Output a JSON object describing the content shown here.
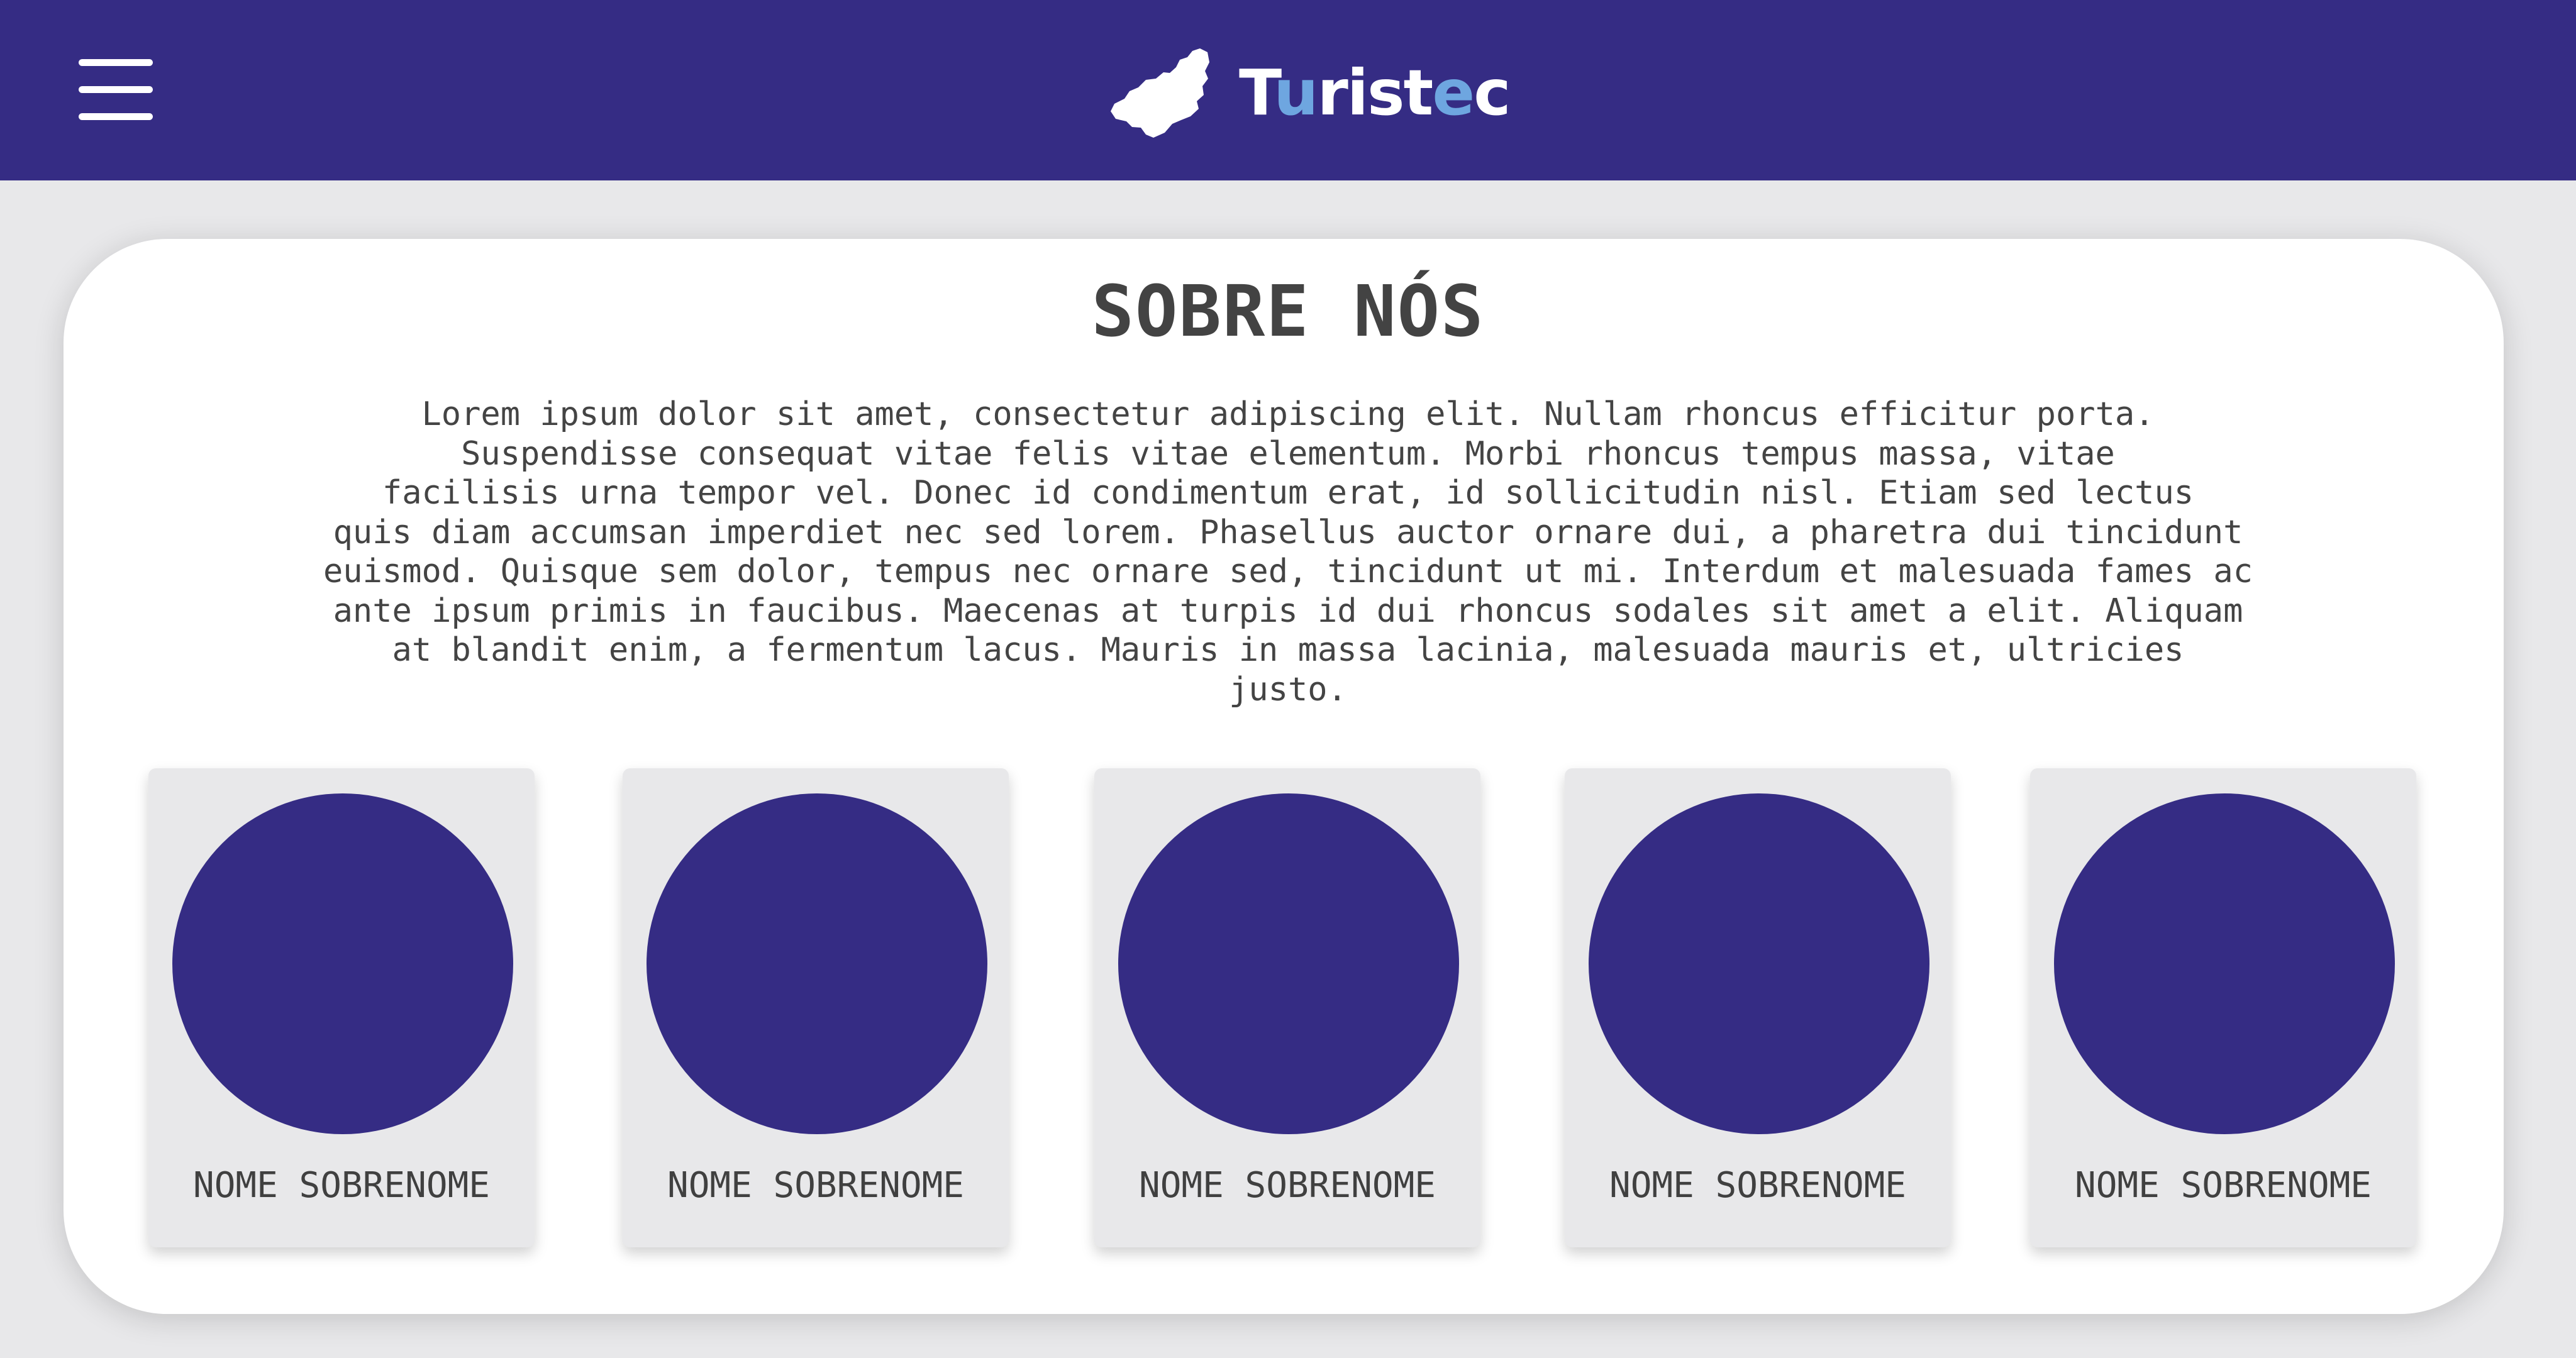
{
  "header": {
    "menu_icon": "hamburger-menu-icon",
    "logo_icon": "island-map-icon",
    "brand": {
      "prefix": "T",
      "accent": "u",
      "middle": "rist",
      "accent2": "e",
      "suffix": "c"
    },
    "colors": {
      "bar": "#352c84",
      "accent": "#6ea6e0",
      "text": "#ffffff"
    }
  },
  "about": {
    "title": "SOBRE NÓS",
    "text": "Lorem ipsum dolor sit amet, consectetur adipiscing elit. Nullam rhoncus efficitur porta.\nSuspendisse consequat vitae felis vitae elementum. Morbi rhoncus tempus massa, vitae\nfacilisis urna tempor vel. Donec id condimentum erat, id sollicitudin nisl. Etiam sed lectus\nquis diam accumsan imperdiet nec sed lorem. Phasellus auctor ornare dui, a pharetra dui tincidunt\neuismod. Quisque sem dolor, tempus nec ornare sed, tincidunt ut mi. Interdum et malesuada fames ac\nante ipsum primis in faucibus. Maecenas at turpis id dui rhoncus sodales sit amet a elit. Aliquam\nat blandit enim, a fermentum lacus. Mauris in massa lacinia, malesuada mauris et, ultricies\njusto."
  },
  "team": [
    {
      "name": "NOME SOBRENOME"
    },
    {
      "name": "NOME SOBRENOME"
    },
    {
      "name": "NOME SOBRENOME"
    },
    {
      "name": "NOME SOBRENOME"
    },
    {
      "name": "NOME SOBRENOME"
    }
  ],
  "colors": {
    "avatar": "#352c84",
    "card": "#ffffff",
    "page": "#e8e8ea"
  }
}
